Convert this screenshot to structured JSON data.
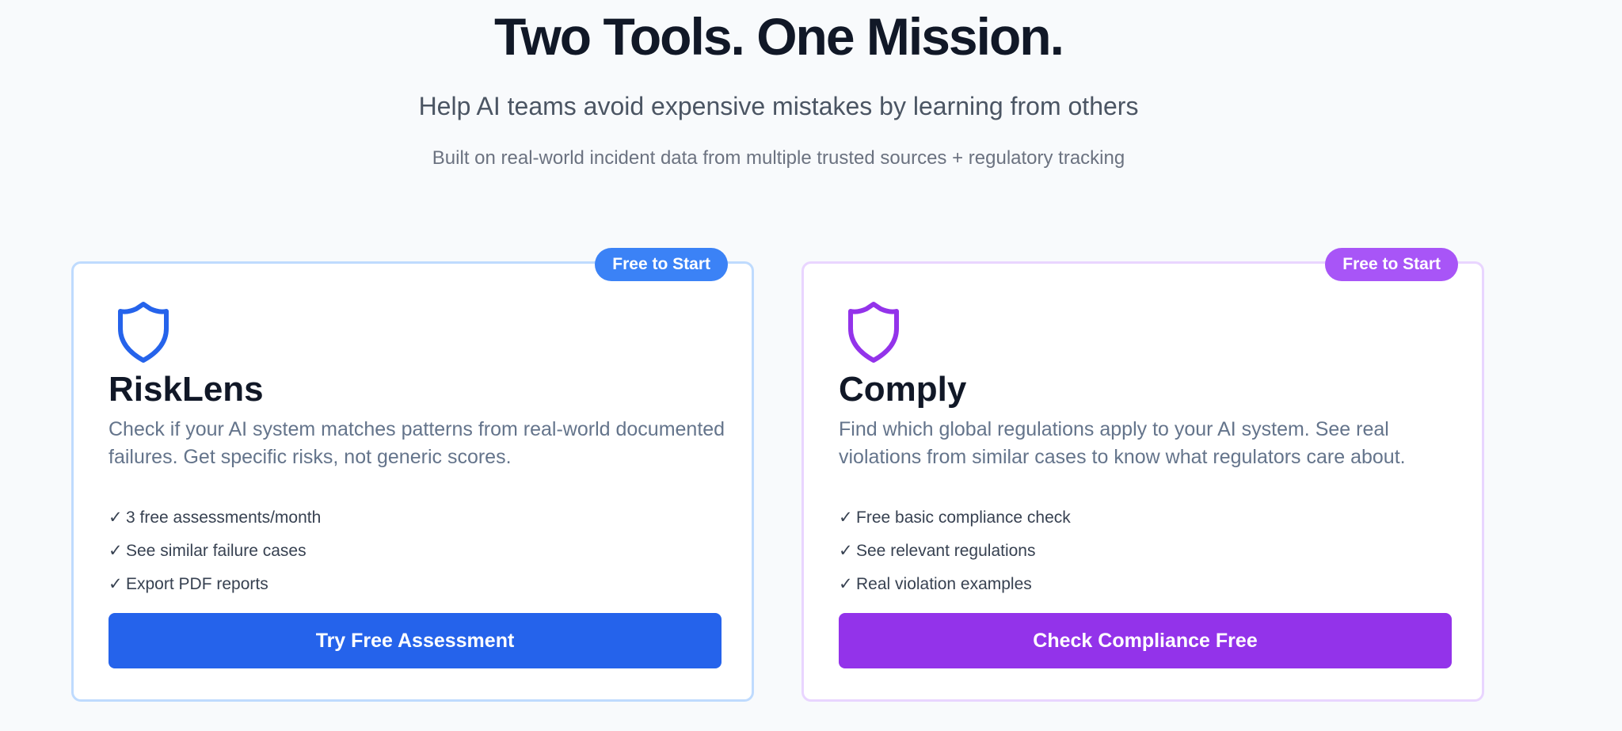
{
  "hero": {
    "title": "Two Tools. One Mission.",
    "subtitle": "Help AI teams avoid expensive mistakes by learning from others",
    "note": "Built on real-world incident data from multiple trusted sources + regulatory tracking"
  },
  "cards": [
    {
      "badge": "Free to Start",
      "icon": "shield-icon",
      "title": "RiskLens",
      "description": "Check if your AI system matches patterns from real-world documented failures. Get specific risks, not generic scores.",
      "features": [
        "3 free assessments/month",
        "See similar failure cases",
        "Export PDF reports"
      ],
      "cta": "Try Free Assessment",
      "accent": "#2563eb",
      "badge_color": "#3b82f6",
      "border_color": "#bfdbfe"
    },
    {
      "badge": "Free to Start",
      "icon": "shield-icon",
      "title": "Comply",
      "description": "Find which global regulations apply to your AI system. See real violations from similar cases to know what regulators care about.",
      "features": [
        "Free basic compliance check",
        "See relevant regulations",
        "Real violation examples"
      ],
      "cta": "Check Compliance Free",
      "accent": "#9333ea",
      "badge_color": "#a855f7",
      "border_color": "#e9d5ff"
    }
  ],
  "check_mark": "✓"
}
